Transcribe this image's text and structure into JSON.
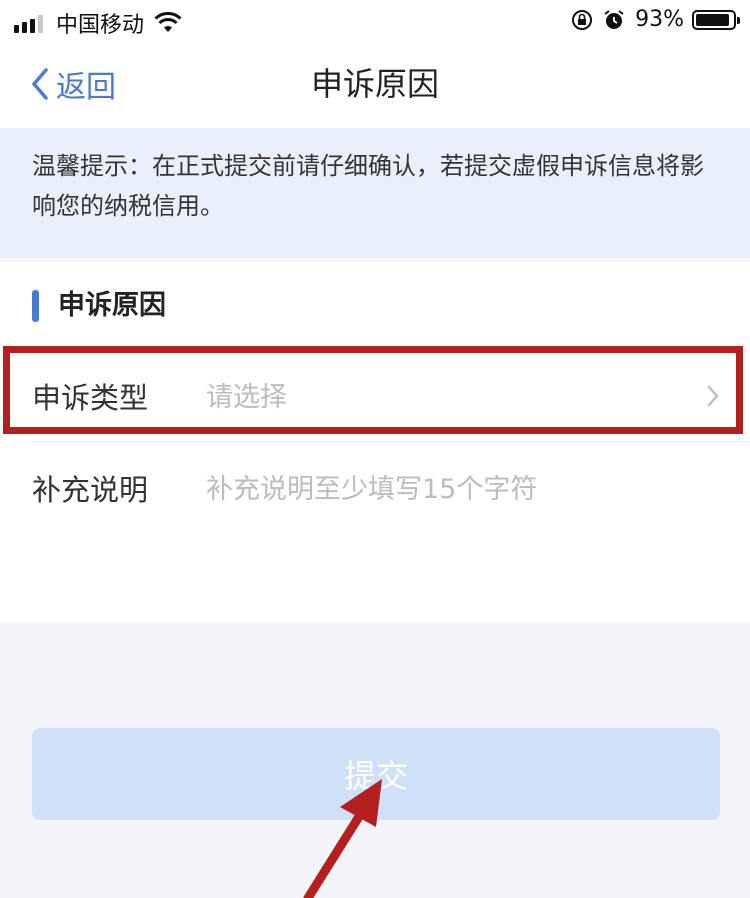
{
  "status_bar": {
    "carrier": "中国移动",
    "battery": "93%",
    "battery_level": 0.93
  },
  "nav": {
    "back_label": "返回",
    "title": "申诉原因"
  },
  "notice": {
    "text": "温馨提示：在正式提交前请仔细确认，若提交虚假申诉信息将影响您的纳税信用。"
  },
  "section": {
    "title": "申诉原因"
  },
  "form": {
    "type_label": "申诉类型",
    "type_placeholder": "请选择",
    "note_label": "补充说明",
    "note_placeholder": "补充说明至少填写15个字符"
  },
  "submit": {
    "label": "提交"
  },
  "colors": {
    "accent": "#4a7bd0",
    "notice_bg": "#e9f0fb",
    "submit_bg": "#cfe1f9",
    "annotation_red": "#b5201e"
  },
  "icons": [
    "signal-icon",
    "wifi-icon",
    "rotation-lock-icon",
    "alarm-icon",
    "battery-icon",
    "chevron-left-icon",
    "chevron-right-icon"
  ]
}
